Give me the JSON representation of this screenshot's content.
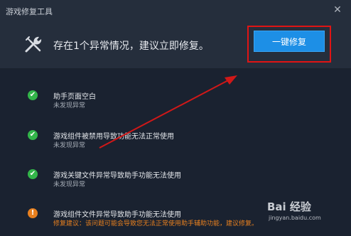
{
  "window": {
    "title": "游戏修复工具",
    "close_glyph": "✕"
  },
  "header": {
    "icon": "wrench-screwdriver-icon",
    "message": "存在1个异常情况，建议立即修复。",
    "fix_button_label": "一键修复"
  },
  "items": [
    {
      "title": "助手页面空白",
      "status_text": "未发现异常",
      "status": "ok",
      "glyph": "✔"
    },
    {
      "title": "游戏组件被禁用导致功能无法正常使用",
      "status_text": "未发现异常",
      "status": "ok",
      "glyph": "✔"
    },
    {
      "title": "游戏关键文件异常导致助手功能无法使用",
      "status_text": "未发现异常",
      "status": "ok",
      "glyph": "✔"
    },
    {
      "title": "游戏组件文件异常导致助手功能无法使用",
      "status_text": "修复建议：该问题可能会导致您无法正常使用助手辅助功能，建议修复。",
      "status": "warning",
      "glyph": "!"
    }
  ],
  "watermark": {
    "main": "Bai 经验",
    "sub": "jingyan.baidu.com"
  },
  "colors": {
    "accent": "#1d8fe6",
    "ok": "#33b54a",
    "warning": "#e8801f",
    "highlight": "#e01414"
  }
}
